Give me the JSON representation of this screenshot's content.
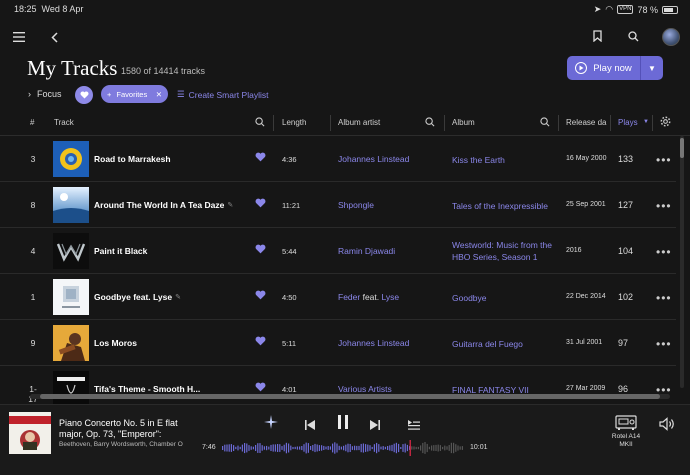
{
  "status_bar": {
    "time": "18:25",
    "date": "Wed 8 Apr",
    "vpn": "VPN",
    "battery": "78 %",
    "battery_level": 0.78
  },
  "nav": {
    "menu_icon": "hamburger-icon",
    "back_icon": "chevron-left-icon",
    "bookmark_icon": "bookmark-icon",
    "search_icon": "search-icon"
  },
  "header": {
    "title": "My Tracks",
    "subtitle": "1580 of 14414 tracks",
    "play_now": "Play now",
    "focus": "Focus",
    "favorites_chip": "Favorites",
    "create_smart_playlist": "Create Smart Playlist"
  },
  "columns": {
    "number": "#",
    "track": "Track",
    "length": "Length",
    "album_artist": "Album artist",
    "album": "Album",
    "release_date": "Release da",
    "plays": "Plays"
  },
  "tracks": [
    {
      "num": "3",
      "name": "Road to Marrakesh",
      "length": "4:36",
      "artist": "Johannes Linstead",
      "feat_artist": "",
      "album": "Kiss the Earth",
      "release": "16 May 2000",
      "plays": "133"
    },
    {
      "num": "8",
      "name": "Around The World In A Tea Daze",
      "length": "11:21",
      "artist": "Shpongle",
      "feat_artist": "",
      "album": "Tales of the Inexpressible",
      "release": "25 Sep 2001",
      "plays": "127"
    },
    {
      "num": "4",
      "name": "Paint it Black",
      "length": "5:44",
      "artist": "Ramin Djawadi",
      "feat_artist": "",
      "album": "Westworld: Music from the HBO Series, Season 1",
      "release": "2016",
      "plays": "104"
    },
    {
      "num": "1",
      "name": "Goodbye feat. Lyse",
      "length": "4:50",
      "artist": "Feder",
      "feat_word": "feat.",
      "feat_artist": "Lyse",
      "album": "Goodbye",
      "release": "22 Dec 2014",
      "plays": "102"
    },
    {
      "num": "9",
      "name": "Los Moros",
      "length": "5:11",
      "artist": "Johannes Linstead",
      "feat_artist": "",
      "album": "Guitarra del Fuego",
      "release": "31 Jul 2001",
      "plays": "97"
    },
    {
      "num": "1-17",
      "name": "Tifa's Theme - Smooth H...",
      "length": "4:01",
      "artist": "Various Artists",
      "feat_artist": "",
      "album": "FINAL FANTASY VII",
      "release": "27 Mar 2009",
      "plays": "96"
    }
  ],
  "now_playing": {
    "title": "Piano Concerto No. 5 in E flat major, Op. 73, \"Emperor\":",
    "artist": "Beethoven, Barry Wordsworth, Chamber O",
    "elapsed": "7:46",
    "total": "10:01",
    "progress": 0.775,
    "device_name": "Rotel A14",
    "device_model": "MKII"
  },
  "colors": {
    "accent": "#6c6ad6",
    "link": "#8b87ea",
    "background": "#161616"
  }
}
